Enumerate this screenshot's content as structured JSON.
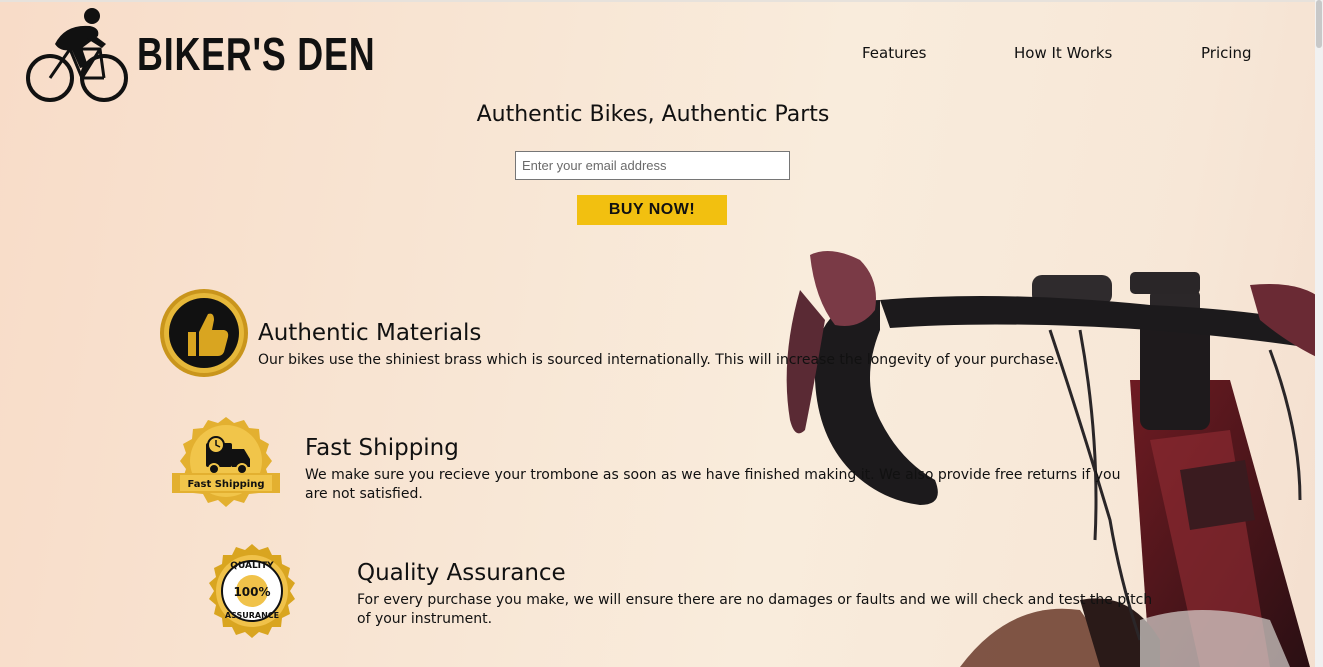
{
  "header": {
    "brand": "BIKER'S DEN",
    "nav": [
      {
        "label": "Features"
      },
      {
        "label": "How It Works"
      },
      {
        "label": "Pricing"
      }
    ]
  },
  "hero": {
    "title": "Authentic Bikes, Authentic Parts",
    "email_placeholder": "Enter your email address",
    "buy_label": "BUY NOW!"
  },
  "features": [
    {
      "icon": "thumbs-up-badge-icon",
      "title": "Authentic Materials",
      "text": "Our bikes use the shiniest brass which is sourced internationally. This will increase the longevity of your purchase."
    },
    {
      "icon": "fast-shipping-badge-icon",
      "badge_label": "Fast Shipping",
      "title": "Fast Shipping",
      "text": "We make sure you recieve your trombone as soon as we have finished making it. We also provide free returns if you are not satisfied."
    },
    {
      "icon": "quality-assurance-badge-icon",
      "badge_label_top": "QUALITY",
      "badge_label_mid": "100%",
      "badge_label_bottom": "ASSURANCE",
      "title": "Quality Assurance",
      "text": "For every purchase you make, we will ensure there are no damages or faults and we will check and test the pitch of your instrument."
    }
  ],
  "colors": {
    "buy_button": "#f2c010",
    "badge_gold": "#d9a520"
  }
}
